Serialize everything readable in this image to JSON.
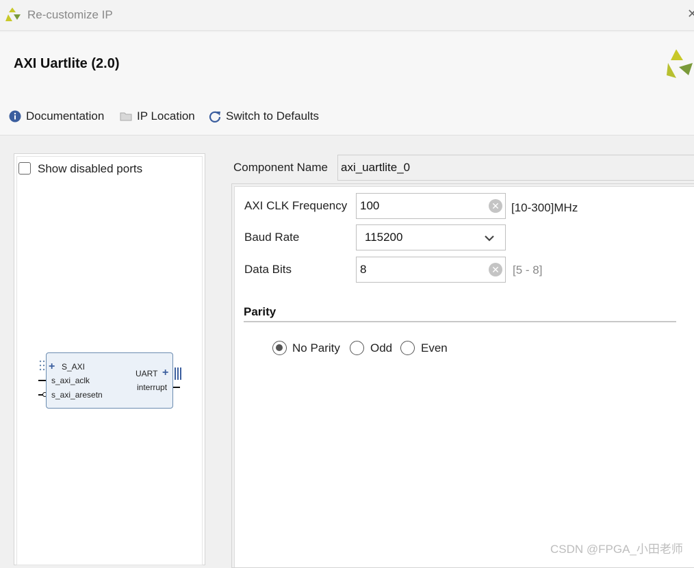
{
  "window": {
    "title": "Re-customize IP",
    "close_glyph": "✕"
  },
  "header": {
    "ip_name": "AXI Uartlite (2.0)"
  },
  "toolbar": {
    "documentation_label": "Documentation",
    "ip_location_label": "IP Location",
    "switch_defaults_label": "Switch to Defaults"
  },
  "left_panel": {
    "show_disabled_ports_label": "Show disabled ports",
    "show_disabled_ports_checked": false,
    "block": {
      "left_ports": [
        "S_AXI",
        "s_axi_aclk",
        "s_axi_aresetn"
      ],
      "right_ports": [
        "UART",
        "interrupt"
      ]
    }
  },
  "component": {
    "label": "Component Name",
    "value": "axi_uartlite_0"
  },
  "params": {
    "axi_clk": {
      "label": "AXI CLK Frequency",
      "value": "100",
      "range": "[10-300]MHz"
    },
    "baud_rate": {
      "label": "Baud Rate",
      "value": "115200"
    },
    "data_bits": {
      "label": "Data Bits",
      "value": "8",
      "range": "[5 - 8]"
    }
  },
  "parity": {
    "title": "Parity",
    "options": [
      "No Parity",
      "Odd",
      "Even"
    ],
    "selected": "No Parity"
  },
  "watermark": "CSDN @FPGA_小田老师",
  "colors": {
    "info_icon": "#3b5e9e",
    "refresh_icon": "#3b5e9e",
    "logo_yellow": "#c8c828",
    "logo_green": "#7a9a3a",
    "block_border": "#6a8bb0",
    "block_fill": "#ebf1f8"
  }
}
